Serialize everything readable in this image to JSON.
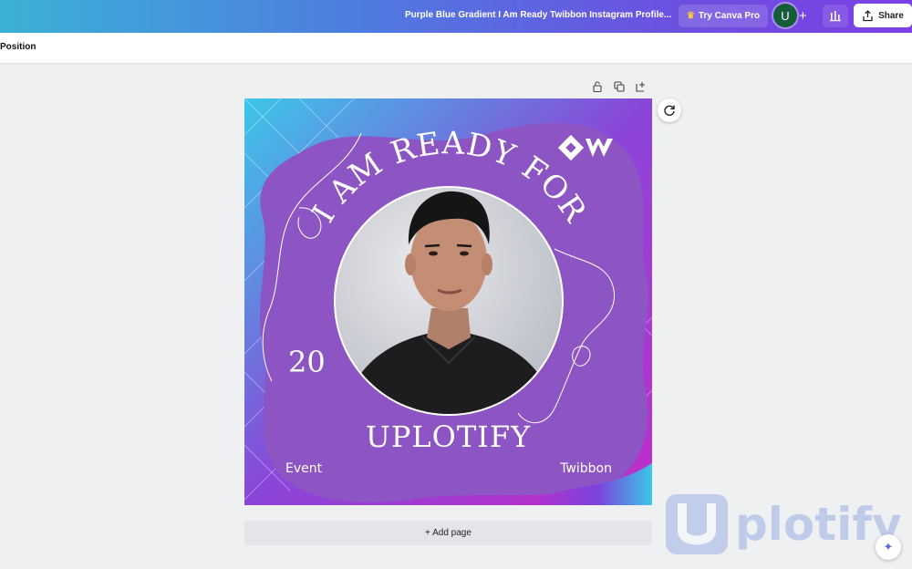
{
  "header": {
    "doc_title": "Purple Blue Gradient I Am Ready Twibbon Instagram Profile...",
    "try_pro_label": "Try Canva Pro",
    "avatar_letter": "U",
    "plus_label": "+",
    "share_label": "Share"
  },
  "toolbar": {
    "position_label": "Position"
  },
  "design": {
    "headline": "I AM READY FOR",
    "year": "20",
    "brand": "UPLOTIFY",
    "left_caption": "Event",
    "right_caption": "Twibbon"
  },
  "footer": {
    "add_page_label": "+ Add page"
  },
  "watermark": {
    "text": "plotify"
  },
  "colors": {
    "purple_bg": "#8c55c3",
    "accent_cyan": "#3cc7e8",
    "accent_magenta": "#c12cc9",
    "top_gradient_start": "#3ab1d6",
    "top_gradient_end": "#7b3fe4"
  }
}
